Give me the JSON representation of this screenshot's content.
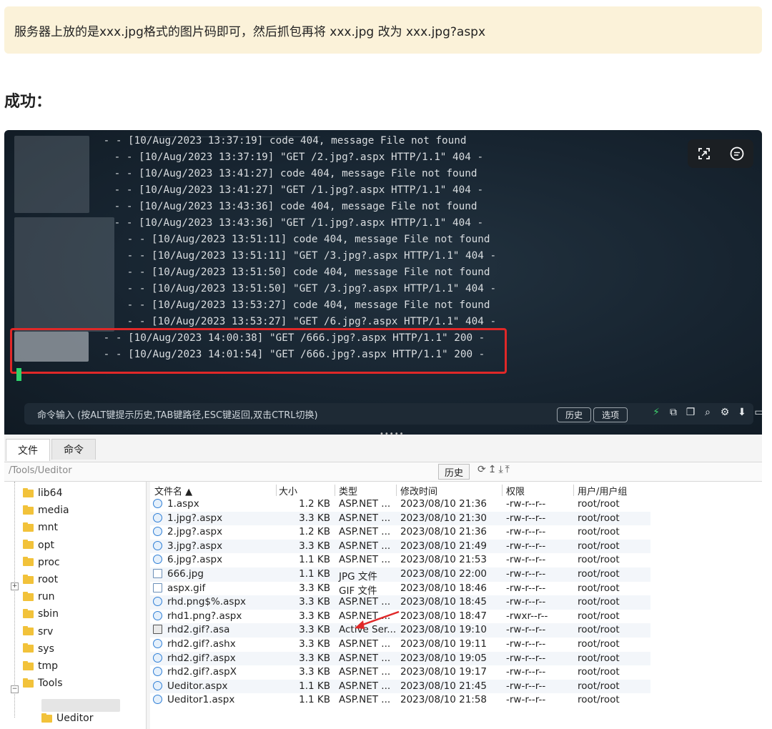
{
  "note": {
    "text": "服务器上放的是xxx.jpg格式的图片码即可，然后抓包再将 xxx.jpg 改为 xxx.jpg?aspx"
  },
  "heading": "成功：",
  "terminal": {
    "lines": [
      " - - [10/Aug/2023 13:37:19] code 404, message File not found",
      " - - [10/Aug/2023 13:37:19] \"GET /2.jpg?.aspx HTTP/1.1\" 404 -",
      " - - [10/Aug/2023 13:41:27] code 404, message File not found",
      " - - [10/Aug/2023 13:41:27] \"GET /1.jpg?.aspx HTTP/1.1\" 404 -",
      " - - [10/Aug/2023 13:43:36] code 404, message File not found",
      " - - [10/Aug/2023 13:43:36] \"GET /1.jpg?.aspx HTTP/1.1\" 404 -",
      " - - [10/Aug/2023 13:51:11] code 404, message File not found",
      " - - [10/Aug/2023 13:51:11] \"GET /3.jpg?.aspx HTTP/1.1\" 404 -",
      " - - [10/Aug/2023 13:51:50] code 404, message File not found",
      " - - [10/Aug/2023 13:51:50] \"GET /3.jpg?.aspx HTTP/1.1\" 404 -",
      " - - [10/Aug/2023 13:53:27] code 404, message File not found",
      " - - [10/Aug/2023 13:53:27] \"GET /6.jpg?.aspx HTTP/1.1\" 404 -",
      " - - [10/Aug/2023 14:00:38] \"GET /666.jpg?.aspx HTTP/1.1\" 200 -",
      " - - [10/Aug/2023 14:01:54] \"GET /666.jpg?.aspx HTTP/1.1\" 200 -"
    ],
    "cmd_placeholder": "命令输入 (按ALT键提示历史,TAB键路径,ESC键返回,双击CTRL切换)",
    "history_btn": "历史",
    "options_btn": "选项",
    "icons": [
      "expand-icon",
      "comment-icon",
      "lightning-icon",
      "copy-icon",
      "paste-icon",
      "search-icon",
      "gear-icon",
      "download-icon",
      "window-icon"
    ]
  },
  "filemanager": {
    "tabs": [
      "文件",
      "命令"
    ],
    "path": "/Tools/Ueditor",
    "history_btn": "历史",
    "tree": [
      "lib64",
      "media",
      "mnt",
      "opt",
      "proc",
      "root",
      "run",
      "sbin",
      "srv",
      "sys",
      "tmp",
      "Tools",
      "Ueditor"
    ],
    "columns": [
      "文件名 ▲",
      "大小",
      "类型",
      "修改时间",
      "权限",
      "用户/用户组"
    ],
    "files": [
      {
        "name": "1.aspx",
        "size": "1.2 KB",
        "type": "ASP.NET ...",
        "mtime": "2023/08/10 21:36",
        "perm": "-rw-r--r--",
        "owner": "root/root",
        "icon": "web"
      },
      {
        "name": "1.jpg?.aspx",
        "size": "3.3 KB",
        "type": "ASP.NET ...",
        "mtime": "2023/08/10 21:30",
        "perm": "-rw-r--r--",
        "owner": "root/root",
        "icon": "web"
      },
      {
        "name": "2.jpg?.aspx",
        "size": "1.2 KB",
        "type": "ASP.NET ...",
        "mtime": "2023/08/10 21:36",
        "perm": "-rw-r--r--",
        "owner": "root/root",
        "icon": "web"
      },
      {
        "name": "3.jpg?.aspx",
        "size": "3.3 KB",
        "type": "ASP.NET ...",
        "mtime": "2023/08/10 21:49",
        "perm": "-rw-r--r--",
        "owner": "root/root",
        "icon": "web"
      },
      {
        "name": "6.jpg?.aspx",
        "size": "1.1 KB",
        "type": "ASP.NET ...",
        "mtime": "2023/08/10 21:53",
        "perm": "-rw-r--r--",
        "owner": "root/root",
        "icon": "web"
      },
      {
        "name": "666.jpg",
        "size": "1.1 KB",
        "type": "JPG 文件",
        "mtime": "2023/08/10 22:00",
        "perm": "-rw-r--r--",
        "owner": "root/root",
        "icon": "doc"
      },
      {
        "name": "aspx.gif",
        "size": "3.3 KB",
        "type": "GIF 文件",
        "mtime": "2023/08/10 18:46",
        "perm": "-rw-r--r--",
        "owner": "root/root",
        "icon": "doc"
      },
      {
        "name": "rhd.png$%.aspx",
        "size": "3.3 KB",
        "type": "ASP.NET ...",
        "mtime": "2023/08/10 18:45",
        "perm": "-rw-r--r--",
        "owner": "root/root",
        "icon": "web"
      },
      {
        "name": "rhd1.png?.aspx",
        "size": "3.3 KB",
        "type": "ASP.NET ...",
        "mtime": "2023/08/10 18:47",
        "perm": "-rwxr--r--",
        "owner": "root/root",
        "icon": "web"
      },
      {
        "name": "rhd2.gif?.asa",
        "size": "3.3 KB",
        "type": "Active Ser...",
        "mtime": "2023/08/10 19:10",
        "perm": "-rw-r--r--",
        "owner": "root/root",
        "icon": "asa"
      },
      {
        "name": "rhd2.gif?.ashx",
        "size": "3.3 KB",
        "type": "ASP.NET ...",
        "mtime": "2023/08/10 19:11",
        "perm": "-rw-r--r--",
        "owner": "root/root",
        "icon": "web"
      },
      {
        "name": "rhd2.gif?.aspx",
        "size": "3.3 KB",
        "type": "ASP.NET ...",
        "mtime": "2023/08/10 19:05",
        "perm": "-rw-r--r--",
        "owner": "root/root",
        "icon": "web"
      },
      {
        "name": "rhd2.gif?.aspX",
        "size": "3.3 KB",
        "type": "ASP.NET ...",
        "mtime": "2023/08/10 19:17",
        "perm": "-rw-r--r--",
        "owner": "root/root",
        "icon": "web"
      },
      {
        "name": "Ueditor.aspx",
        "size": "1.1 KB",
        "type": "ASP.NET ...",
        "mtime": "2023/08/10 21:45",
        "perm": "-rw-r--r--",
        "owner": "root/root",
        "icon": "web"
      },
      {
        "name": "Ueditor1.aspx",
        "size": "1.1 KB",
        "type": "ASP.NET ...",
        "mtime": "2023/08/10 21:58",
        "perm": "-rw-r--r--",
        "owner": "root/root",
        "icon": "web"
      }
    ]
  },
  "colors": {
    "note_bg": "#fbf2d9",
    "highlight_box": "#e02828",
    "cursor": "#2ed36b",
    "arrow": "#e02828"
  }
}
